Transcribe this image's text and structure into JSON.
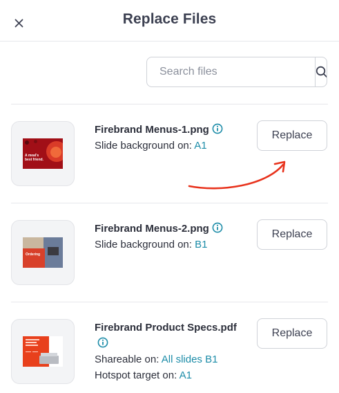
{
  "header": {
    "title": "Replace Files",
    "close_icon": "close-icon"
  },
  "search": {
    "placeholder": "Search files",
    "value": "",
    "icon": "search-icon"
  },
  "files": [
    {
      "name": "Firebrand Menus-1.png",
      "usage_label": "Slide background on:",
      "usage_links": [
        "A1"
      ],
      "button_label": "Replace",
      "thumbnail": {
        "caption_line1": "A meal's",
        "caption_line2": "best friend.",
        "theme_color": "#b3121a"
      }
    },
    {
      "name": "Firebrand Menus-2.png",
      "usage_label": "Slide background on:",
      "usage_links": [
        "B1"
      ],
      "button_label": "Replace",
      "thumbnail": {
        "caption": "Ordering",
        "theme_color": "#d8402a"
      }
    },
    {
      "name": "Firebrand Product Specs.pdf",
      "usage_label": "Shareable on:",
      "usage_links": [
        "All slides",
        "B1"
      ],
      "usage2_label": "Hotspot target on:",
      "usage2_links": [
        "A1"
      ],
      "button_label": "Replace",
      "thumbnail": {
        "theme_color": "#e8401c"
      }
    }
  ],
  "colors": {
    "link": "#1c8ca8",
    "annotation_arrow": "#e8321c",
    "title": "#3d4152"
  }
}
